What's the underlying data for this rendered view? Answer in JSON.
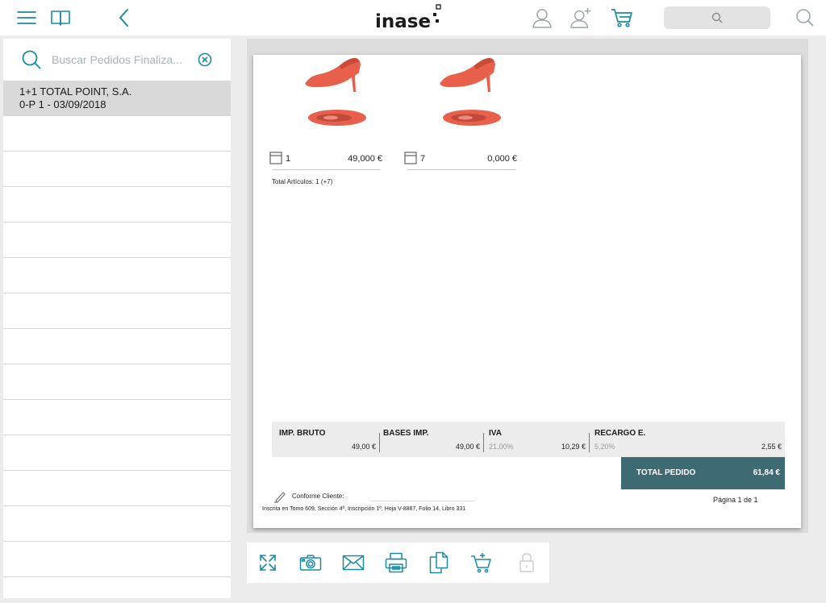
{
  "header": {
    "logo": "inase",
    "search_placeholder": ""
  },
  "sidebar": {
    "search_placeholder": "Buscar Pedidos Finaliza...",
    "items": [
      {
        "title": "1+1 TOTAL POINT, S.A.",
        "subtitle": "0-P 1 - 03/09/2018",
        "selected": true
      }
    ]
  },
  "document": {
    "articles": [
      {
        "qty": "1",
        "price": "49,000 €"
      },
      {
        "qty": "7",
        "price": "0,000 €"
      }
    ],
    "total_articulos": "Total Artículos: 1 (+7)",
    "totals": {
      "imp_bruto_label": "IMP. BRUTO",
      "imp_bruto_value": "49,00 €",
      "bases_label": "BASES IMP.",
      "bases_value": "49,00 €",
      "iva_label": "IVA",
      "iva_rate": "21,00%",
      "iva_value": "10,29 €",
      "recargo_label": "RECARGO E.",
      "recargo_rate": "5,20%",
      "recargo_value": "2,55 €"
    },
    "total_pedido_label": "TOTAL PEDIDO",
    "total_pedido_value": "61,84 €",
    "conforme_label": "Conforme Cliente:",
    "pagina": "Página 1 de 1",
    "legal": "Inscrita en Tomo 609, Sección 4ª, Inscripción 1ª, Hoja V-8887, Folio 14, Libro 331"
  },
  "colors": {
    "accent": "#1b8aa0",
    "total_bg": "#3e6a73",
    "shoe": "#e8604c"
  },
  "icons": [
    "menu-icon",
    "book-icon",
    "back-icon",
    "user-icon",
    "add-user-icon",
    "cart-icon",
    "search-icon",
    "expand-icon",
    "camera-icon",
    "mail-icon",
    "print-icon",
    "copy-icon",
    "cart-add-icon",
    "lock-icon"
  ]
}
